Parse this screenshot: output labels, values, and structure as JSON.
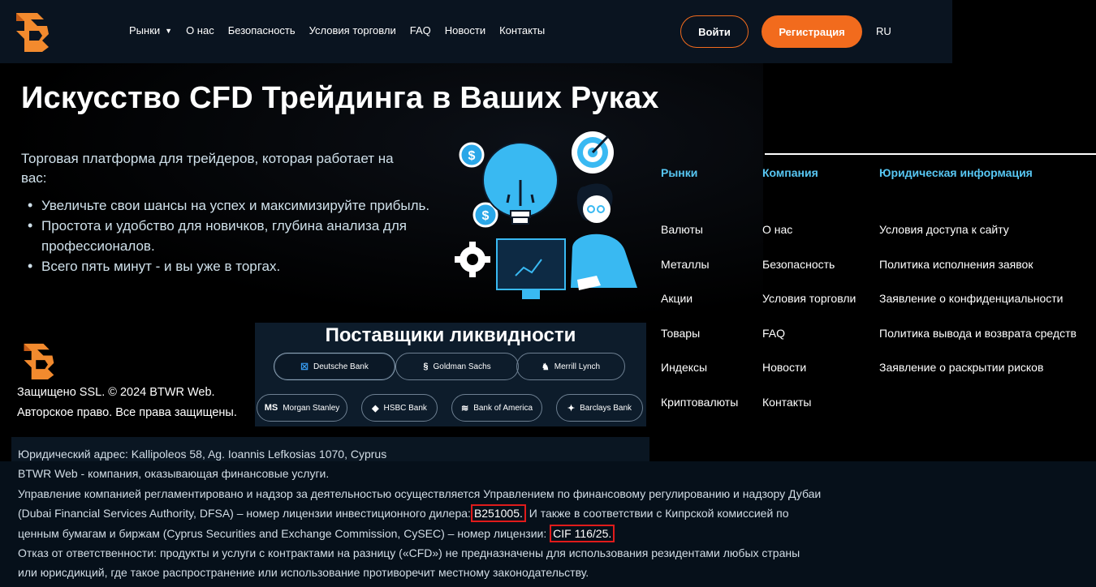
{
  "header": {
    "nav": [
      {
        "label": "Рынки",
        "has_dropdown": true
      },
      {
        "label": "О нас"
      },
      {
        "label": "Безопасность"
      },
      {
        "label": "Условия торговли"
      },
      {
        "label": "FAQ"
      },
      {
        "label": "Новости"
      },
      {
        "label": "Контакты"
      }
    ],
    "login_label": "Войти",
    "register_label": "Регистрация",
    "language": "RU"
  },
  "hero": {
    "title": "Искусство CFD Трейдинга в Ваших Руках",
    "subtitle": "Торговая платформа для трейдеров, которая работает на вас:",
    "bullets": [
      "Увеличьте свои шансы на успех и максимизируйте прибыль.",
      "Простота и удобство для новичков, глубина анализа для профессионалов.",
      "Всего пять минут - и вы уже в торгах."
    ]
  },
  "footer_columns": [
    {
      "heading": "Рынки",
      "links": [
        "Валюты",
        "Металлы",
        "Акции",
        "Товары",
        "Индексы",
        "Криптовалюты"
      ]
    },
    {
      "heading": "Компания",
      "links": [
        "О нас",
        "Безопасность",
        "Условия торговли",
        "FAQ",
        "Новости",
        "Контакты"
      ]
    },
    {
      "heading": "Юридическая информация",
      "links": [
        "Условия доступа к сайту",
        "Политика исполнения заявок",
        "Заявление о конфиденциальности",
        "Политика вывода и возврата средств",
        "Заявление о раскрытии рисков"
      ]
    }
  ],
  "copyright": {
    "line1": "Защищено SSL. © 2024 BTWR Web.",
    "line2": "Авторское право. Все права защищены."
  },
  "liquidity": {
    "title": "Поставщики ликвидности",
    "providers": [
      {
        "name": "Deutsche Bank",
        "icon": "☒"
      },
      {
        "name": "Goldman Sachs",
        "icon": "§"
      },
      {
        "name": "Merrill Lynch",
        "icon": "♞"
      },
      {
        "name": "Morgan Stanley",
        "icon": "MS"
      },
      {
        "name": "HSBC Bank",
        "icon": "◆"
      },
      {
        "name": "Bank of America",
        "icon": "≋"
      },
      {
        "name": "Barclays Bank",
        "icon": "✦"
      }
    ]
  },
  "legal": {
    "address": "Юридический адрес: Kallipoleos 58, Ag. Ioannis Lefkosias 1070, Cyprus",
    "company": "BTWR Web - компания, оказывающая финансовые услуги.",
    "regulation_l1": "Управление компанией регламентировано и надзор за деятельностью осуществляется Управлением по финансовому регулированию и надзору Дубаи",
    "regulation_l2a": "(Dubai Financial Services Authority, DFSA) – номер лицензии инвестиционного дилера:",
    "license_dfsa": "B251005.",
    "regulation_l2b": " И также в соответствии с Кипрской комиссией по",
    "regulation_l3a": "ценным бумагам и биржам (Cyprus Securities and Exchange Commission, CySEC) – номер лицензии:",
    "license_cysec": "CIF 116/25.",
    "disclaimer_l1": "Отказ от ответственности: продукты и услуги с контрактами на разницу («CFD») не предназначены для использования резидентами любых страны",
    "disclaimer_l2": "или юрисдикций, где такое распространение или использование противоречит местному законодательству."
  },
  "colors": {
    "accent": "#f26b1d",
    "link_heading": "#58c7f3",
    "header_bg": "#0a1420",
    "highlight_box": "#e01b1b"
  }
}
